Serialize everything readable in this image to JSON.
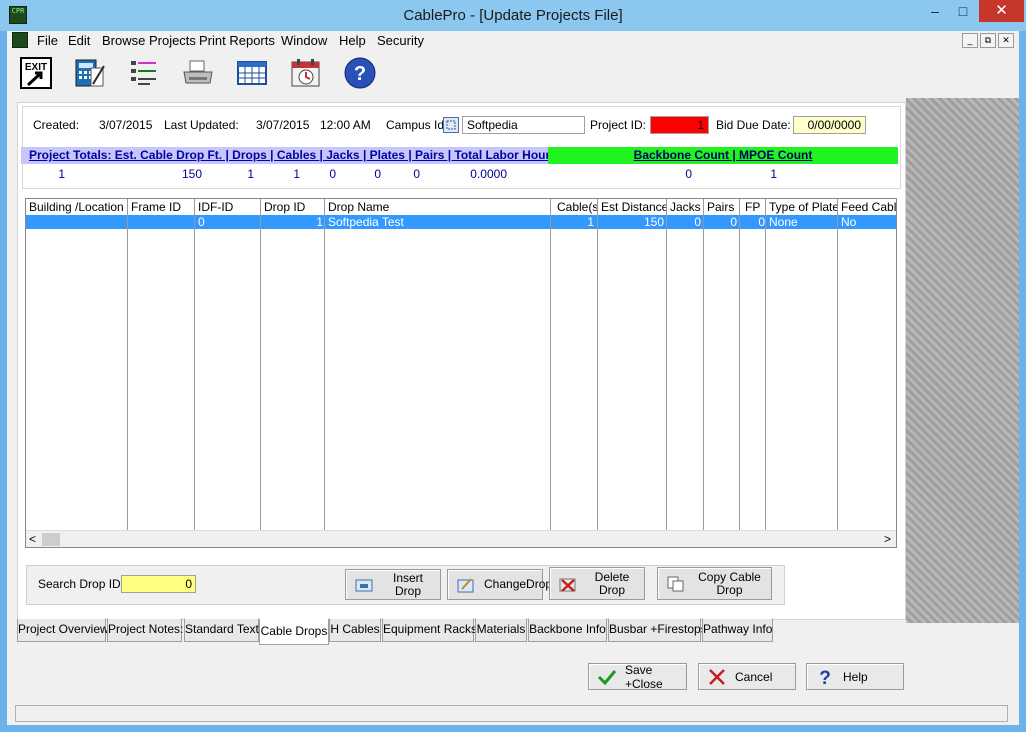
{
  "window": {
    "title": "CablePro - [Update Projects File]",
    "min": "–",
    "max": "□",
    "close": "✕"
  },
  "menu": [
    "File",
    "Edit",
    "Browse Projects",
    "Print Reports",
    "Window",
    "Help",
    "Security"
  ],
  "toolbar": {
    "exit_label": "EXIT",
    "help_glyph": "?"
  },
  "info": {
    "created_label": "Created:",
    "created": "3/07/2015",
    "updated_label": "Last Updated:",
    "updated_date": "3/07/2015",
    "updated_time": "12:00 AM",
    "campus_label": "Campus Id:",
    "campus": "Softpedia",
    "project_id_label": "Project ID:",
    "project_id": "1",
    "bid_label": "Bid Due Date:",
    "bid": "0/00/0000"
  },
  "totals": {
    "header": "Project Totals:   Est. Cable Drop Ft. | Drops | Cables | Jacks | Plates | Pairs | Total Labor Hours",
    "backbone_header": "Backbone Count | MPOE Count",
    "values": [
      "1",
      "150",
      "1",
      "1",
      "0",
      "0",
      "0",
      "0.0000"
    ],
    "backbone": "0",
    "mpoe": "1"
  },
  "grid": {
    "columns": [
      "Building /Location",
      "Frame ID",
      "IDF-ID",
      "Drop ID",
      "Drop Name",
      "Cable(s)",
      "Est Distance",
      "Jacks",
      "Pairs",
      "FP",
      "Type of Plate",
      "Feed Cable"
    ],
    "rows": [
      [
        "",
        "",
        "0",
        "1",
        "Softpedia Test",
        "1",
        "150",
        "0",
        "0",
        "0",
        "None",
        "No"
      ]
    ],
    "scroll_left": "<",
    "scroll_right": ">"
  },
  "search": {
    "label": "Search Drop ID:",
    "value": "0"
  },
  "actions": {
    "insert": "Insert Drop",
    "change": "ChangeDrop",
    "delete": "Delete Drop",
    "copy": "Copy Cable Drop"
  },
  "tabs": [
    "Project Overview",
    "Project Notes:",
    "Standard Text",
    "Cable Drops",
    "H Cables",
    "Equipment Racks",
    "Materials",
    "Backbone Info",
    "Busbar +Firestops",
    "Pathway Info"
  ],
  "active_tab": "Cable Drops",
  "footer": {
    "save": "Save +Close",
    "cancel": "Cancel",
    "help": "Help"
  },
  "colors": {
    "selection": "#3399ff",
    "totals_header": "#c6c6f9",
    "backbone_header": "#21f321",
    "project_id": "#ff0000",
    "search_bg": "#ffff80",
    "bid_bg": "#ffffcc"
  }
}
